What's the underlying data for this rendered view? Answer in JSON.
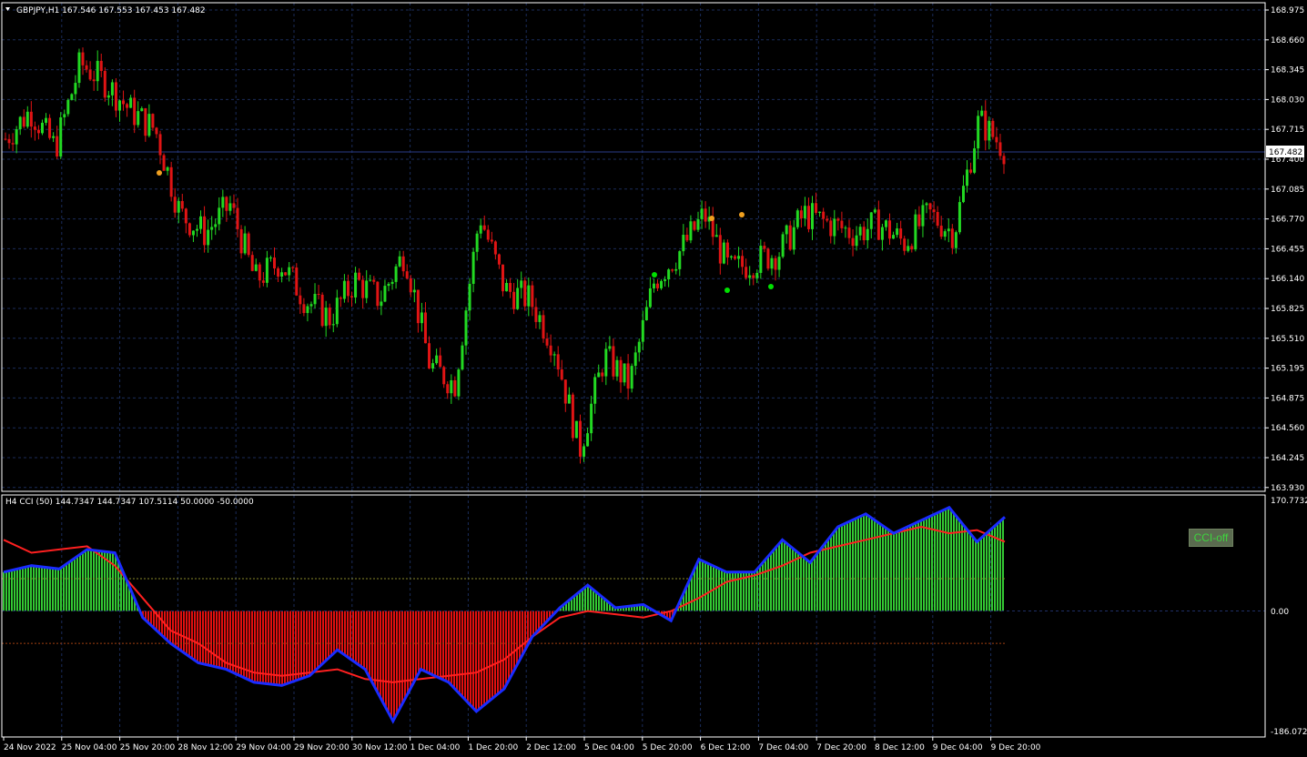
{
  "price_chart": {
    "header": "GBPJPY,H1  167.546 167.553 167.453 167.482",
    "current_price_label": "167.482",
    "price_axis": [
      "168.975",
      "168.660",
      "168.345",
      "168.030",
      "167.715",
      "167.400",
      "167.085",
      "166.770",
      "166.455",
      "166.140",
      "165.825",
      "165.510",
      "165.195",
      "164.875",
      "164.560",
      "164.245",
      "163.930"
    ],
    "colors": {
      "bull": "#22d922",
      "bear": "#e01414",
      "grid": "#1b2c5a",
      "background": "#000000",
      "signal_up": "#00e000",
      "signal_down": "#f0a020"
    }
  },
  "indicator": {
    "header": "H4 CCI (50) 144.7347 144.7347 107.5114 50.0000 -50.0000",
    "axis": [
      "170.7732",
      "0.00",
      "-186.0721"
    ],
    "toggle_label": "CCI-off",
    "colors": {
      "positive": "#33c833",
      "negative": "#e01010",
      "line": "#1a2cff",
      "signal": "#ff2020",
      "level_pos": "#8a8a2a",
      "level_neg": "#a04010"
    }
  },
  "time_axis": [
    "24 Nov 2022",
    "25 Nov 04:00",
    "25 Nov 20:00",
    "28 Nov 12:00",
    "29 Nov 04:00",
    "29 Nov 20:00",
    "30 Nov 12:00",
    "1 Dec 04:00",
    "1 Dec 20:00",
    "2 Dec 12:00",
    "5 Dec 04:00",
    "5 Dec 20:00",
    "6 Dec 12:00",
    "7 Dec 04:00",
    "7 Dec 20:00",
    "8 Dec 12:00",
    "9 Dec 04:00",
    "9 Dec 20:00"
  ],
  "chart_data": [
    {
      "type": "line",
      "title": "GBPJPY,H1",
      "series": [
        {
          "name": "GBPJPY,H1",
          "values": [
            167.6,
            167.9,
            167.5,
            168.4,
            168.2,
            167.9,
            167.7,
            166.8,
            166.6,
            166.9,
            166.1,
            166.3,
            165.9,
            165.7,
            166.1,
            165.9,
            166.4,
            165.2,
            165.0,
            166.8,
            166.0,
            165.9,
            165.4,
            164.3,
            165.3,
            165.0,
            166.1,
            166.4,
            166.8,
            166.2,
            166.3,
            166.4,
            166.8,
            166.7,
            166.6,
            166.7,
            166.5,
            166.8,
            166.6,
            167.8,
            167.5
          ]
        }
      ],
      "ylim": [
        163.93,
        168.975
      ]
    },
    {
      "type": "area",
      "title": "H4 CCI (50)",
      "series": [
        {
          "name": "CCI (50)",
          "values": [
            60,
            70,
            65,
            95,
            90,
            -10,
            -50,
            -80,
            -90,
            -110,
            -115,
            -100,
            -60,
            -90,
            -170,
            -90,
            -110,
            -155,
            -120,
            -40,
            5,
            40,
            5,
            10,
            -15,
            80,
            60,
            60,
            110,
            75,
            130,
            150,
            120,
            140,
            160,
            107,
            145
          ]
        },
        {
          "name": "signal",
          "values": [
            110,
            90,
            95,
            100,
            70,
            20,
            -30,
            -50,
            -80,
            -95,
            -100,
            -95,
            -90,
            -105,
            -110,
            -105,
            -100,
            -95,
            -75,
            -40,
            -10,
            0,
            -5,
            -10,
            0,
            20,
            45,
            55,
            70,
            90,
            100,
            110,
            120,
            130,
            120,
            125,
            107
          ]
        }
      ],
      "levels": [
        50,
        -50
      ],
      "ylim": [
        -186.0721,
        170.7732
      ]
    }
  ]
}
